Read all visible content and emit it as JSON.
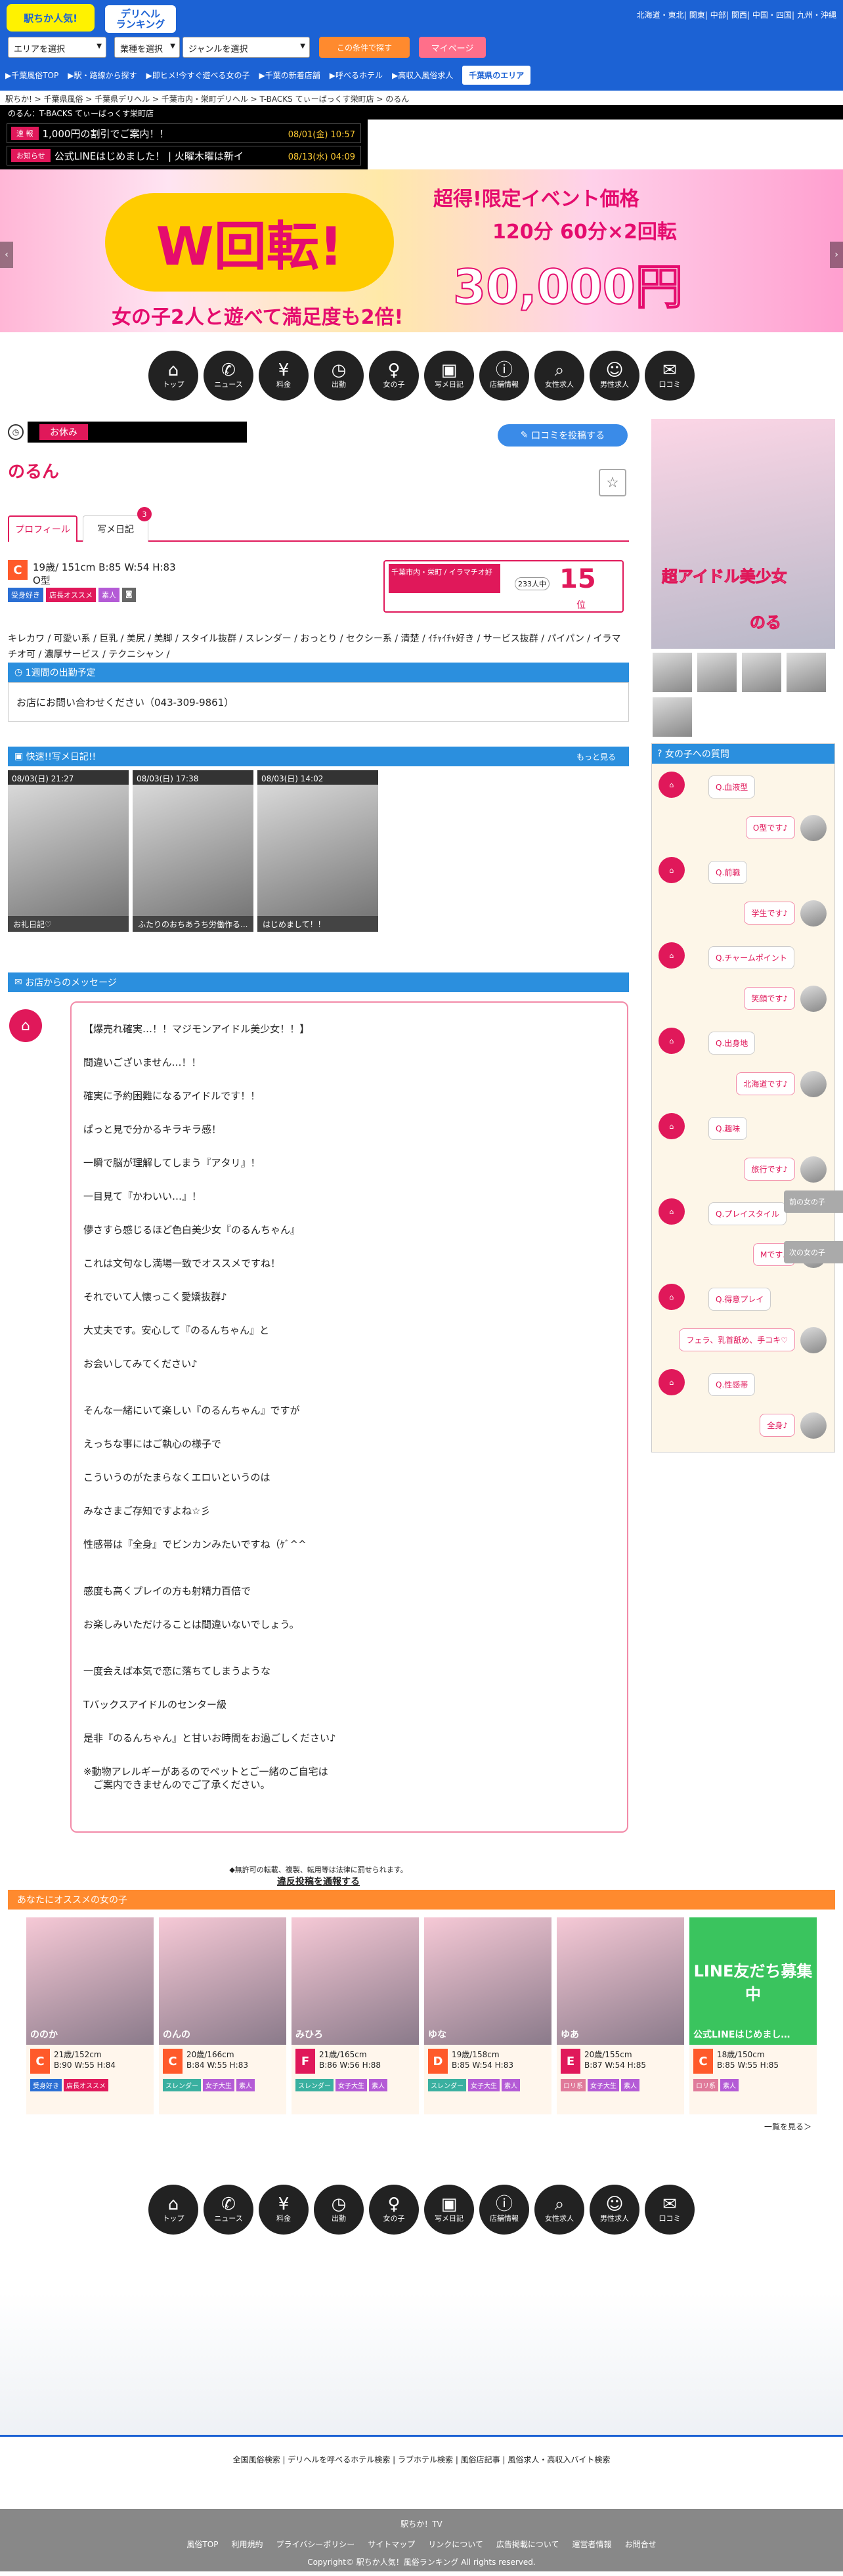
{
  "header": {
    "logo": "駅ちか人気!",
    "deli": [
      "デリヘル",
      "ランキング"
    ],
    "regions": [
      "北海道・東北",
      "関東",
      "中部",
      "関西",
      "中国・四国",
      "九州・沖縄"
    ],
    "selects": [
      "エリアを選択",
      "業種を選択",
      "ジャンルを選択"
    ],
    "cond_button": "この条件で探す",
    "my_button": "マイページ",
    "nav": [
      "▶千葉風俗TOP",
      "▶駅・路線から探す",
      "▶即ヒメ!今すぐ遊べる女の子",
      "▶千葉の新着店舗",
      "▶呼べるホテル",
      "▶高収入風俗求人"
    ],
    "area_button": "千葉県のエリア"
  },
  "breadcrumb": "駅ちか! > 千葉県風俗 > 千葉県デリヘル > 千葉市内・栄町デリヘル > T-BACKS てぃーばっくす栄町店 > のるん",
  "blackbar": "のるん：T-BACKS てぃーばっくす栄町店",
  "ticker": [
    {
      "label": "速 報",
      "text": "1,000円の割引でご案内！！",
      "date": "08/01(金) 10:57"
    },
    {
      "label": "お知らせ",
      "text": "公式LINEはじめました！ | 火曜木曜は新イ",
      "date": "08/13(水) 04:09"
    }
  ],
  "banner": {
    "t1": "超得!限定イベント価格",
    "t2": "120分 60分×2回転",
    "price": "30,000円",
    "big": "W回転!",
    "sub": "女の子2人と遊べて満足度も2倍!"
  },
  "icons": [
    {
      "g": "⌂",
      "label": "トップ"
    },
    {
      "g": "✆",
      "label": "ニュース"
    },
    {
      "g": "¥",
      "label": "料金"
    },
    {
      "g": "◷",
      "label": "出勤"
    },
    {
      "g": "♀",
      "label": "女の子"
    },
    {
      "g": "▣",
      "label": "写メ日記"
    },
    {
      "g": "ⓘ",
      "label": "店舗情報"
    },
    {
      "g": "⌕",
      "label": "女性求人"
    },
    {
      "g": "☺",
      "label": "男性求人"
    },
    {
      "g": "✉",
      "label": "口コミ"
    }
  ],
  "girl": {
    "status": "お休み",
    "post_button": "口コミを投稿する",
    "name": "のるん",
    "tabs": [
      "プロフィール",
      "写メ日記"
    ],
    "diary_badge": "3",
    "cup": "C",
    "spec": "19歳/ 151cm B:85 W:54 H:83",
    "blood": "O型",
    "tags": [
      {
        "t": "受身好き",
        "c": "#2b6fd4"
      },
      {
        "t": "店長オススメ",
        "c": "#e0185a"
      },
      {
        "t": "素人",
        "c": "#b45bd6"
      }
    ],
    "rank_label": "千葉市内・栄町 / イラマチオ好",
    "rank_count": "233人中",
    "rank_num": "15",
    "rank_unit": "位",
    "keywords": "キレカワ / 可愛い系 / 巨乳 / 美尻 / 美脚 / スタイル抜群 / スレンダー / おっとり / セクシー系 / 清楚 / ｲﾁｬｲﾁｬ好き / サービス抜群 / パイパン / イラマチオ可 / 濃厚サービス / テクニシャン /",
    "sched_title": "1週間の出勤予定",
    "sched_text": "お店にお問い合わせください（043-309-9861）",
    "diary_title": "快速!!写メ日記!!",
    "diary_more": "もっと見る",
    "diary": [
      {
        "d": "08/03(日) 21:27",
        "t": "お礼日記♡"
      },
      {
        "d": "08/03(日) 17:38",
        "t": "ふたりのおちあうち労働作る..."
      },
      {
        "d": "08/03(日) 14:02",
        "t": "はじめまして！！"
      }
    ],
    "msg_title": "お店からのメッセージ",
    "message": [
      "【爆売れ確実…！！マジモンアイドル美少女！！】",
      "間違いございません…！！",
      "確実に予約困難になるアイドルです！！",
      "ぱっと見で分かるキラキラ感！",
      "一瞬で脳が理解してしまう『アタリ』！",
      "一目見て『かわいい…』！",
      "儚さすら感じるほど色白美少女『のるんちゃん』",
      "これは文句なし満場一致でオススメですね！",
      "それでいて人懐っこく愛嬌抜群♪",
      "大丈夫です。安心して『のるんちゃん』と",
      "お会いしてみてください♪",
      "\nそんな一緒にいて楽しい『のるんちゃん』ですが",
      "えっちな事にはご執心の様子で",
      "こういうのがたまらなくエロいというのは",
      "みなさまご存知ですよね☆彡",
      "性感帯は『全身』でビンカンみたいですね（ｹﾞ^^",
      "\n感度も高くプレイの方も射精力百倍で",
      "お楽しみいただけることは間違いないでしょう。",
      "\n一度会えば本気で恋に落ちてしまうような",
      "Tバックスアイドルのセンター級",
      "是非『のるんちゃん』と甘いお時間をお過ごしください♪",
      "※動物アレルギーがあるのでペットとご一緒のご自宅は\n　ご案内できませんのでご了承ください。"
    ],
    "report_note": "◆無許可の転載、複製、転用等は法律に罰せられます。",
    "report_link": "違反投稿を通報する"
  },
  "side": {
    "thumb_text": "超アイドル美少女",
    "thumb_name": "のる",
    "q_title": "女の子への質問",
    "qa": [
      {
        "q": "Q.血液型",
        "a": "O型です♪"
      },
      {
        "q": "Q.前職",
        "a": "学生です♪"
      },
      {
        "q": "Q.チャームポイント",
        "a": "笑顔です♪"
      },
      {
        "q": "Q.出身地",
        "a": "北海道です♪"
      },
      {
        "q": "Q.趣味",
        "a": "旅行です♪"
      },
      {
        "q": "Q.プレイスタイル",
        "a": "Mです♪"
      },
      {
        "q": "Q.得意プレイ",
        "a": "フェラ、乳首舐め、手コキ♡"
      },
      {
        "q": "Q.性感帯",
        "a": "全身♪"
      }
    ],
    "tab_prev": "前の女の子",
    "tab_next": "次の女の子"
  },
  "reco": {
    "title": "あなたにオススメの女の子",
    "more": "一覧を見る＞",
    "cards": [
      {
        "n": "ののか",
        "cup": "C",
        "cc": "#ff5a2a",
        "s1": "21歳/152cm",
        "s2": "B:90 W:55 H:84",
        "tags": [
          {
            "t": "受身好き",
            "c": "#2b6fd4"
          },
          {
            "t": "店長オススメ",
            "c": "#e0185a"
          }
        ]
      },
      {
        "n": "のんの",
        "cup": "C",
        "cc": "#ff5a2a",
        "s1": "20歳/166cm",
        "s2": "B:84 W:55 H:83",
        "tags": [
          {
            "t": "スレンダー",
            "c": "#3ab0a0"
          },
          {
            "t": "女子大生",
            "c": "#b45bd6"
          },
          {
            "t": "素人",
            "c": "#b45bd6"
          }
        ]
      },
      {
        "n": "みひろ",
        "cup": "F",
        "cc": "#e0185a",
        "s1": "21歳/165cm",
        "s2": "B:86 W:56 H:88",
        "tags": [
          {
            "t": "スレンダー",
            "c": "#3ab0a0"
          },
          {
            "t": "女子大生",
            "c": "#b45bd6"
          },
          {
            "t": "素人",
            "c": "#b45bd6"
          }
        ]
      },
      {
        "n": "ゆな",
        "cup": "D",
        "cc": "#ff5a2a",
        "s1": "19歳/158cm",
        "s2": "B:85 W:54 H:83",
        "tags": [
          {
            "t": "スレンダー",
            "c": "#3ab0a0"
          },
          {
            "t": "女子大生",
            "c": "#b45bd6"
          },
          {
            "t": "素人",
            "c": "#b45bd6"
          }
        ]
      },
      {
        "n": "ゆあ",
        "cup": "E",
        "cc": "#e0185a",
        "s1": "20歳/155cm",
        "s2": "B:87 W:54 H:85",
        "tags": [
          {
            "t": "ロリ系",
            "c": "#e07a9a"
          },
          {
            "t": "女子大生",
            "c": "#b45bd6"
          },
          {
            "t": "素人",
            "c": "#b45bd6"
          }
        ]
      },
      {
        "n": "公式LINEはじめまし…",
        "cup": "C",
        "cc": "#ff5a2a",
        "s1": "18歳/150cm",
        "s2": "B:85 W:55 H:85",
        "tags": [
          {
            "t": "ロリ系",
            "c": "#e07a9a"
          },
          {
            "t": "素人",
            "c": "#b45bd6"
          }
        ],
        "line": "LINE友だち募集中"
      }
    ]
  },
  "footer": {
    "links": [
      "全国風俗検索",
      "デリヘルを呼べるホテル検索",
      "ラブホテル検索",
      "風俗店記事",
      "風俗求人・高収入バイト検索"
    ],
    "brand": "駅ちか！TV",
    "sublinks": [
      "風俗TOP",
      "利用規約",
      "プライバシーポリシー",
      "サイトマップ",
      "リンクについて",
      "広告掲載について",
      "運営者情報",
      "お問合せ"
    ],
    "copy": "Copyright© 駅ちか人気！風俗ランキング All rights reserved."
  }
}
